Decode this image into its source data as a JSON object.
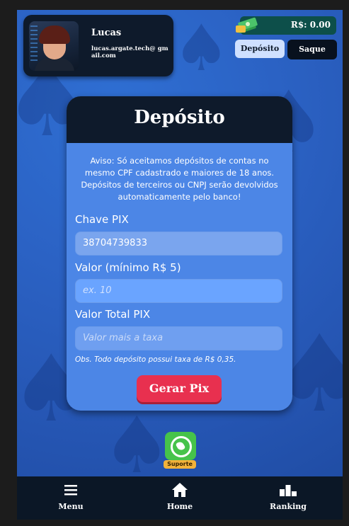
{
  "profile": {
    "username": "Lucas",
    "email": "lucas.argate.tech@\ngmail.com"
  },
  "balance": {
    "text": "R$: 0.00",
    "deposit_label": "Depósito",
    "withdraw_label": "Saque"
  },
  "deposit_card": {
    "title": "Depósito",
    "notice": "Aviso: Só aceitamos depósitos de contas no mesmo CPF cadastrado e maiores de 18 anos. Depósitos de terceiros ou CNPJ serão devolvidos automaticamente pelo banco!",
    "pix_key_label": "Chave PIX",
    "pix_key_value": "38704739833",
    "amount_label": "Valor (mínimo R$ 5)",
    "amount_placeholder": "ex. 10",
    "total_label": "Valor Total PIX",
    "total_placeholder": "Valor mais a taxa",
    "obs": "Obs. Todo depósito possui taxa de R$ 0,35.",
    "generate_label": "Gerar Pix"
  },
  "support": {
    "label": "Suporte"
  },
  "nav": {
    "items": [
      {
        "label": "Menu",
        "icon": "menu-icon"
      },
      {
        "label": "Home",
        "icon": "home-icon"
      },
      {
        "label": "Ranking",
        "icon": "ranking-icon"
      }
    ]
  },
  "colors": {
    "background_blue": "#2b62c4",
    "card_blue": "#4c86e6",
    "dark_navy": "#0e1a2b",
    "accent_red": "#e8304f",
    "balance_green": "#0d4f4a",
    "whatsapp_green": "#46c34a"
  }
}
